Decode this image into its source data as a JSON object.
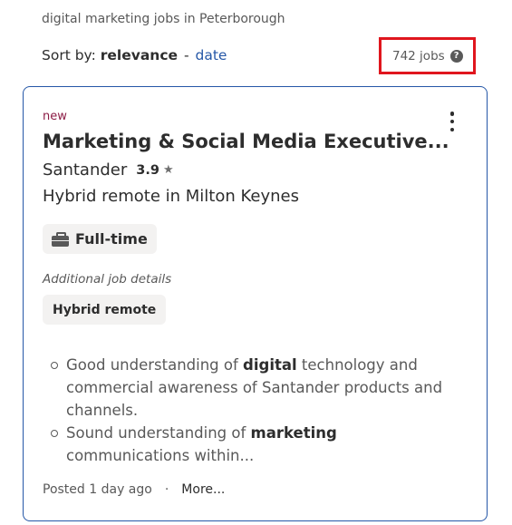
{
  "search": {
    "caption": "digital marketing jobs in Peterborough"
  },
  "sort": {
    "label": "Sort by:",
    "active": "relevance",
    "separator": "-",
    "alternate": "date"
  },
  "results": {
    "count_text": "742 jobs",
    "help_glyph": "?"
  },
  "job": {
    "badge": "new",
    "title": "Marketing & Social Media Executive...",
    "company": "Santander",
    "rating": "3.9",
    "rating_star": "★",
    "location": "Hybrid remote in Milton Keynes",
    "job_type": "Full-time",
    "additional_label": "Additional job details",
    "additional_tag": "Hybrid remote",
    "snippet": [
      {
        "pre": "Good understanding of ",
        "strong": "digital",
        "post": " technology and commercial awareness of Santander products and channels."
      },
      {
        "pre": "Sound understanding of ",
        "strong": "marketing",
        "post": " communications within..."
      }
    ],
    "posted": "Posted 1 day ago",
    "footer_separator": "·",
    "more_label": "More..."
  },
  "icons": {
    "briefcase": "briefcase-icon",
    "kebab": "more-options-icon",
    "help": "help-icon",
    "star": "star-icon"
  },
  "colors": {
    "link": "#2557a7",
    "badge": "#8c1c45",
    "highlight_border": "#e0161e",
    "card_border": "#2557a7"
  }
}
